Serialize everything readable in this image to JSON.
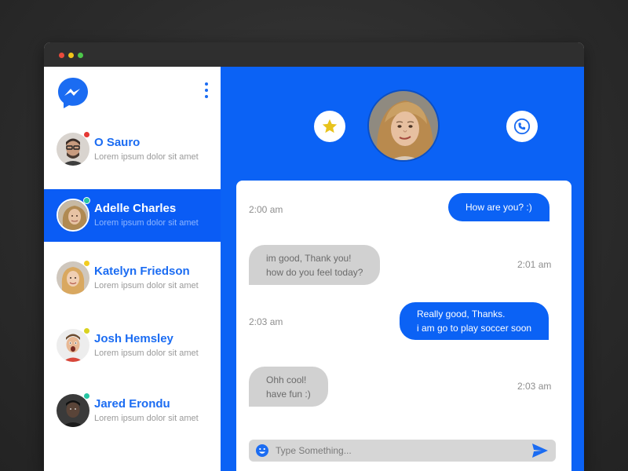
{
  "colors": {
    "brand_blue": "#0b62f5",
    "active_row": "#0a5cf5",
    "incoming_bubble": "#d1d1d1"
  },
  "window": {
    "controls": [
      "close",
      "minimize",
      "maximize"
    ]
  },
  "sidebar": {
    "logo_icon": "messenger-logo-icon",
    "menu_icon": "kebab-menu-icon",
    "contacts": [
      {
        "name": "O Sauro",
        "preview": "Lorem ipsum dolor sit amet",
        "status_color": "#e53935"
      },
      {
        "name": "Adelle Charles",
        "preview": "Lorem ipsum dolor sit amet",
        "status_color": "#26c6a3"
      },
      {
        "name": "Katelyn Friedson",
        "preview": "Lorem ipsum dolor sit amet",
        "status_color": "#f2cc1f"
      },
      {
        "name": "Josh Hemsley",
        "preview": "Lorem ipsum dolor sit amet",
        "status_color": "#d9d21f"
      },
      {
        "name": "Jared Erondu",
        "preview": "Lorem ipsum dolor sit amet",
        "status_color": "#26c6a3"
      }
    ],
    "active_index": 1
  },
  "header": {
    "favorite_icon": "star-icon",
    "call_icon": "phone-icon"
  },
  "messages": [
    {
      "direction": "out",
      "time": "2:00 am",
      "lines": [
        "How are you? :)"
      ]
    },
    {
      "direction": "in",
      "time": "2:01 am",
      "lines": [
        "im good, Thank you!",
        "how do you feel today?"
      ]
    },
    {
      "direction": "out",
      "time": "2:03 am",
      "lines": [
        "Really good, Thanks.",
        "i am go to play soccer soon"
      ]
    },
    {
      "direction": "in",
      "time": "2:03 am",
      "lines": [
        "Ohh cool!",
        "have fun :)"
      ]
    }
  ],
  "composer": {
    "placeholder": "Type Something...",
    "value": "",
    "emoji_icon": "emoji-icon",
    "send_icon": "send-icon"
  }
}
